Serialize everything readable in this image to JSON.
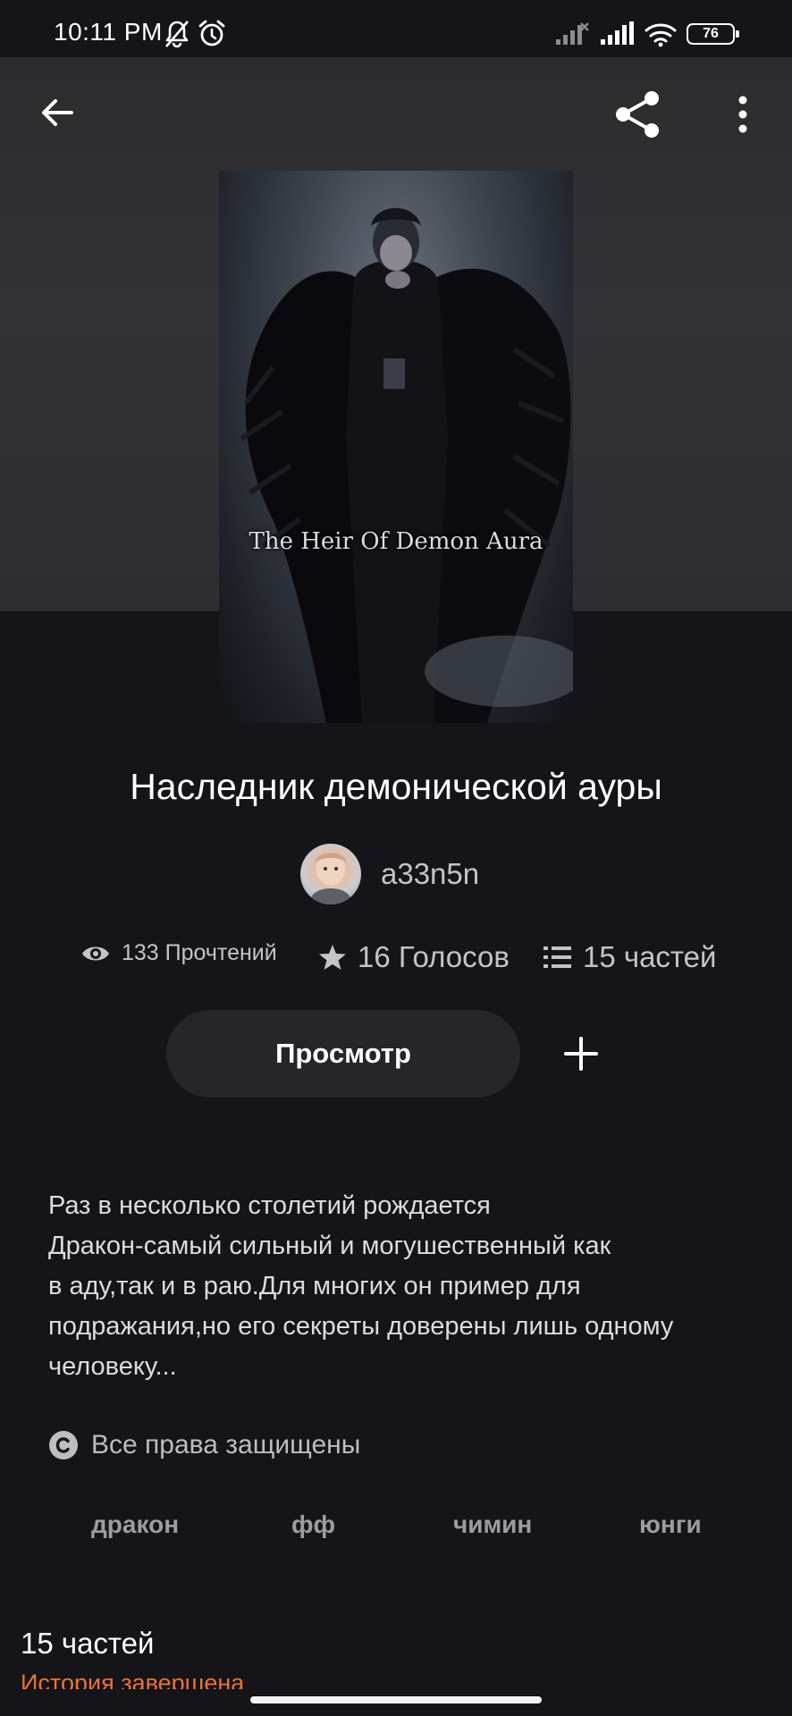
{
  "status_bar": {
    "time": "10:11 PM",
    "battery_level": "76",
    "icons": [
      "bell-off-icon",
      "alarm-icon",
      "signal-off-icon",
      "signal-icon",
      "wifi-icon",
      "battery-icon"
    ]
  },
  "toolbar": {
    "back_icon": "arrow-left-icon",
    "share_icon": "share-icon",
    "more_icon": "more-vertical-icon"
  },
  "cover": {
    "overlay_text": "The Heir Of Demon Aura"
  },
  "story": {
    "title": "Наследник демонической ауры",
    "author": "a33n5n",
    "stats": {
      "reads": "133 Прочтений",
      "votes": "16 Голосов",
      "parts": "15 частей"
    },
    "read_button_label": "Просмотр",
    "add_icon": "plus-icon",
    "description_lines": [
      "Раз в несколько столетий рождается",
      "Дракон-самый сильный и могушественный как",
      "в аду,так и в раю.Для многих он пример для",
      "подражания,но его секреты доверены лишь одному",
      "человеку..."
    ],
    "copyright": "Все права защищены",
    "tags": [
      "дракон",
      "фф",
      "чимин",
      "юнги"
    ],
    "parts_heading": "15 частей",
    "parts_status": "История завершена"
  },
  "colors": {
    "background": "#151418",
    "header_background": "#313134",
    "button_background": "#262529",
    "accent_orange": "#e8733a",
    "muted_text": "#c4c4c8",
    "tag_text": "#9c9ca1"
  }
}
